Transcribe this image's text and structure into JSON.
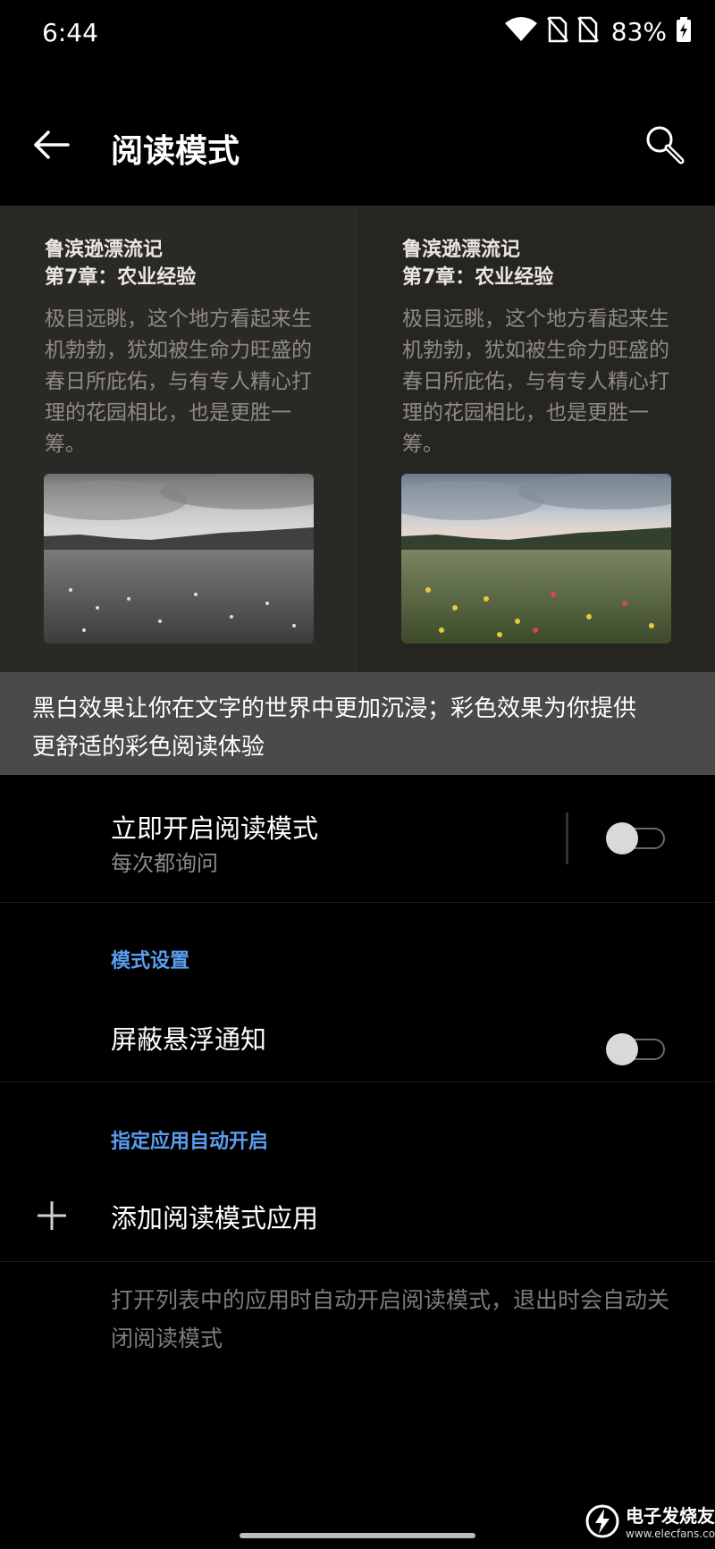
{
  "status_bar": {
    "time": "6:44",
    "battery": "83%",
    "icons": [
      "wifi-icon",
      "no-sim-icon",
      "no-sim-icon",
      "battery-charging-icon"
    ]
  },
  "app_bar": {
    "title": "阅读模式",
    "back_icon": "arrow-left-icon",
    "search_icon": "search-icon"
  },
  "preview": {
    "left": {
      "book_title": "鲁滨逊漂流记",
      "chapter": "第7章：农业经验",
      "body": "极目远眺，这个地方看起来生机勃勃，犹如被生命力旺盛的春日所庇佑，与有专人精心打理的花园相比，也是更胜一筹。",
      "image": "grayscale-meadow-photo"
    },
    "right": {
      "book_title": "鲁滨逊漂流记",
      "chapter": "第7章：农业经验",
      "body": "极目远眺，这个地方看起来生机勃勃，犹如被生命力旺盛的春日所庇佑，与有专人精心打理的花园相比，也是更胜一筹。",
      "image": "color-meadow-photo"
    }
  },
  "info_banner": {
    "line1": "黑白效果让你在文字的世界中更加沉浸；彩色效果为你提供",
    "line2": "更舒适的彩色阅读体验"
  },
  "settings": {
    "instant_reading": {
      "title": "立即开启阅读模式",
      "subtitle": "每次都询问",
      "enabled": false
    },
    "mode_settings_header": "模式设置",
    "block_notifications": {
      "title": "屏蔽悬浮通知",
      "enabled": false
    },
    "auto_apps_header": "指定应用自动开启",
    "add_app": {
      "title": "添加阅读模式应用",
      "icon": "plus-icon"
    },
    "footnote": "打开列表中的应用时自动开启阅读模式，退出时会自动关闭阅读模式"
  },
  "watermark": {
    "top": "电子发烧友",
    "bottom": "www.elecfans.com"
  },
  "colors": {
    "accent": "#5b9df0",
    "background": "#000000",
    "banner": "#4a4a4a"
  }
}
